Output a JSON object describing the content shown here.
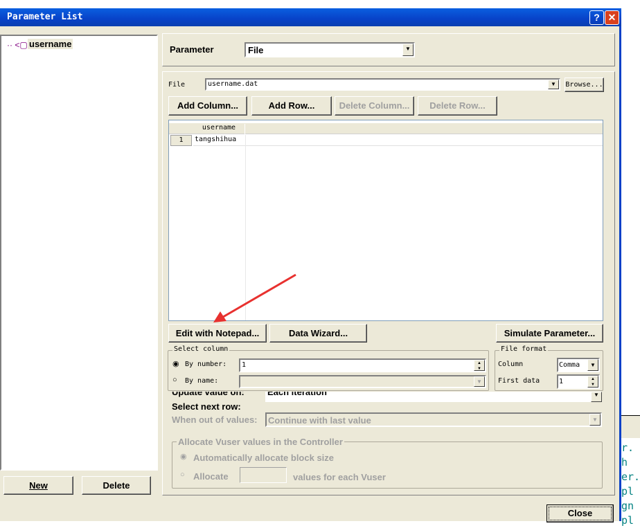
{
  "window": {
    "title": "Parameter List",
    "help": "?",
    "close": "✕"
  },
  "tree": {
    "items": [
      {
        "label": "username"
      }
    ]
  },
  "left_buttons": {
    "new": "New",
    "delete": "Delete"
  },
  "parameter": {
    "label": "Parameter",
    "type": "File"
  },
  "file": {
    "label": "File",
    "value": "username.dat",
    "browse": "Browse..."
  },
  "toolbar": {
    "add_column": "Add Column...",
    "add_row": "Add Row...",
    "delete_column": "Delete Column...",
    "delete_row": "Delete Row..."
  },
  "grid": {
    "columns": [
      "username"
    ],
    "rows": [
      {
        "num": "1",
        "cells": [
          "tangshihua"
        ]
      }
    ]
  },
  "actions": {
    "edit_notepad": "Edit with Notepad...",
    "data_wizard": "Data Wizard...",
    "simulate": "Simulate Parameter..."
  },
  "select_column": {
    "title": "Select column",
    "by_number": "By number:",
    "by_number_value": "1",
    "by_name": "By name:",
    "selected": "by_number"
  },
  "file_format": {
    "title": "File format",
    "column_label": "Column",
    "column_value": "Comma",
    "first_data_label": "First data",
    "first_data_value": "1"
  },
  "update": {
    "label": "Update value on:",
    "value": "Each iteration"
  },
  "select_next_row": {
    "label": "Select next row:"
  },
  "out_of_values": {
    "label": "When out of values:",
    "value": "Continue with last value"
  },
  "allocate": {
    "title": "Allocate Vuser values in the Controller",
    "auto": "Automatically allocate block size",
    "allocate": "Allocate",
    "suffix": "values for each Vuser"
  },
  "close_button": "Close",
  "background_text": [
    "r. h",
    "er.",
    "pl",
    "gn",
    "pl"
  ],
  "annotation": {
    "arrow_color": "#e8312f"
  }
}
